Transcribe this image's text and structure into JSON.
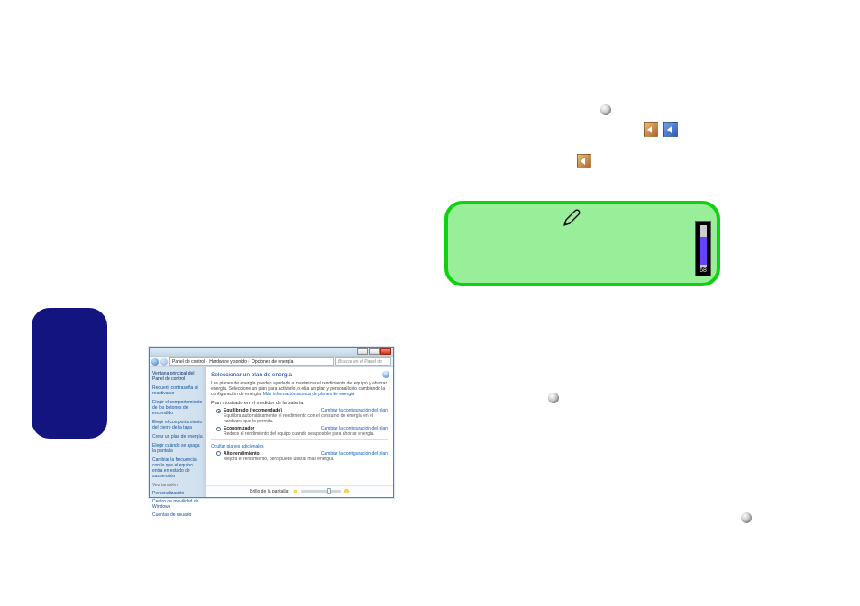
{
  "spheres": {
    "count": 3
  },
  "green_panel": {
    "pen_label": "pen",
    "volume": {
      "value": 68,
      "max": 100,
      "label": "68"
    }
  },
  "win7": {
    "titlebar": {
      "min": "_",
      "max": "□",
      "close": "×"
    },
    "breadcrumb": {
      "root_icon": "control-panel-icon",
      "parts": [
        "Panel de control",
        "Hardware y sonido",
        "Opciones de energía"
      ]
    },
    "search_placeholder": "Buscar en el Panel de control",
    "sidebar": {
      "home": "Ventana principal del Panel de control",
      "links": [
        "Requerir contraseña al reactivarse",
        "Elegir el comportamiento de los botones de encendido",
        "Elegir el comportamiento del cierre de la tapa",
        "Crear un plan de energía",
        "Elegir cuándo se apaga la pantalla",
        "Cambiar la frecuencia con la que el equipo entra en estado de suspensión"
      ],
      "see_also_hdr": "Vea también",
      "see_also": [
        "Personalización",
        "Centro de movilidad de Windows",
        "Cuentas de usuario"
      ]
    },
    "content": {
      "heading": "Seleccionar un plan de energía",
      "desc_pre": "Los planes de energía pueden ayudarle a maximizar el rendimiento del equipo y ahorrar energía. Seleccione un plan para activarlo, o elija un plan y personalícelo cambiando la configuración de energía. ",
      "desc_link": "Más información acerca de planes de energía",
      "section_hdr": "Plan mostrado en el medidor de la batería",
      "plan1": {
        "title": "Equilibrado (recomendado)",
        "sub": "Equilibra automáticamente el rendimiento con el consumo de energía en el hardware que lo permita.",
        "link": "Cambiar la configuración del plan",
        "checked": true
      },
      "plan2": {
        "title": "Economizador",
        "sub": "Reduce el rendimiento del equipo cuando sea posible para ahorrar energía.",
        "link": "Cambiar la configuración del plan",
        "checked": false
      },
      "extra_hdr": "Ocultar planes adicionales",
      "plan3": {
        "title": "Alto rendimiento",
        "sub": "Mejora el rendimiento, pero puede utilizar más energía.",
        "link": "Cambiar la configuración del plan",
        "checked": false
      },
      "brightness": {
        "label": "Brillo de la pantalla:",
        "value": 70,
        "min_icon": "☼",
        "max_icon": "☀"
      },
      "help": "?"
    }
  }
}
